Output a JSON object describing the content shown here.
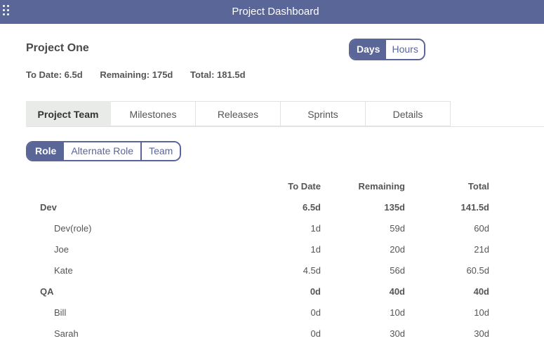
{
  "header": {
    "title": "Project Dashboard",
    "apps_icon": "grid-dots-icon"
  },
  "project": {
    "name": "Project One"
  },
  "units": {
    "options": [
      "Days",
      "Hours"
    ],
    "selected": "Days"
  },
  "summary": {
    "to_date_label": "To Date:",
    "to_date_value": "6.5d",
    "remaining_label": "Remaining:",
    "remaining_value": "175d",
    "total_label": "Total:",
    "total_value": "181.5d"
  },
  "tabs": [
    {
      "label": "Project Team",
      "active": true
    },
    {
      "label": "Milestones",
      "active": false
    },
    {
      "label": "Releases",
      "active": false
    },
    {
      "label": "Sprints",
      "active": false
    },
    {
      "label": "Details",
      "active": false
    }
  ],
  "group_by": {
    "options": [
      "Role",
      "Alternate Role",
      "Team"
    ],
    "selected": "Role"
  },
  "table": {
    "columns": [
      "",
      "To Date",
      "Remaining",
      "Total"
    ],
    "groups": [
      {
        "name": "Dev",
        "to_date": "6.5d",
        "remaining": "135d",
        "total": "141.5d",
        "members": [
          {
            "name": "Dev(role)",
            "to_date": "1d",
            "remaining": "59d",
            "total": "60d"
          },
          {
            "name": "Joe",
            "to_date": "1d",
            "remaining": "20d",
            "total": "21d"
          },
          {
            "name": "Kate",
            "to_date": "4.5d",
            "remaining": "56d",
            "total": "60.5d"
          }
        ]
      },
      {
        "name": "QA",
        "to_date": "0d",
        "remaining": "40d",
        "total": "40d",
        "members": [
          {
            "name": "Bill",
            "to_date": "0d",
            "remaining": "10d",
            "total": "10d"
          },
          {
            "name": "Sarah",
            "to_date": "0d",
            "remaining": "30d",
            "total": "30d"
          }
        ]
      }
    ]
  },
  "colors": {
    "accent": "#5a6598",
    "active_tab_bg": "#e8ebe8",
    "text": "#555555"
  }
}
